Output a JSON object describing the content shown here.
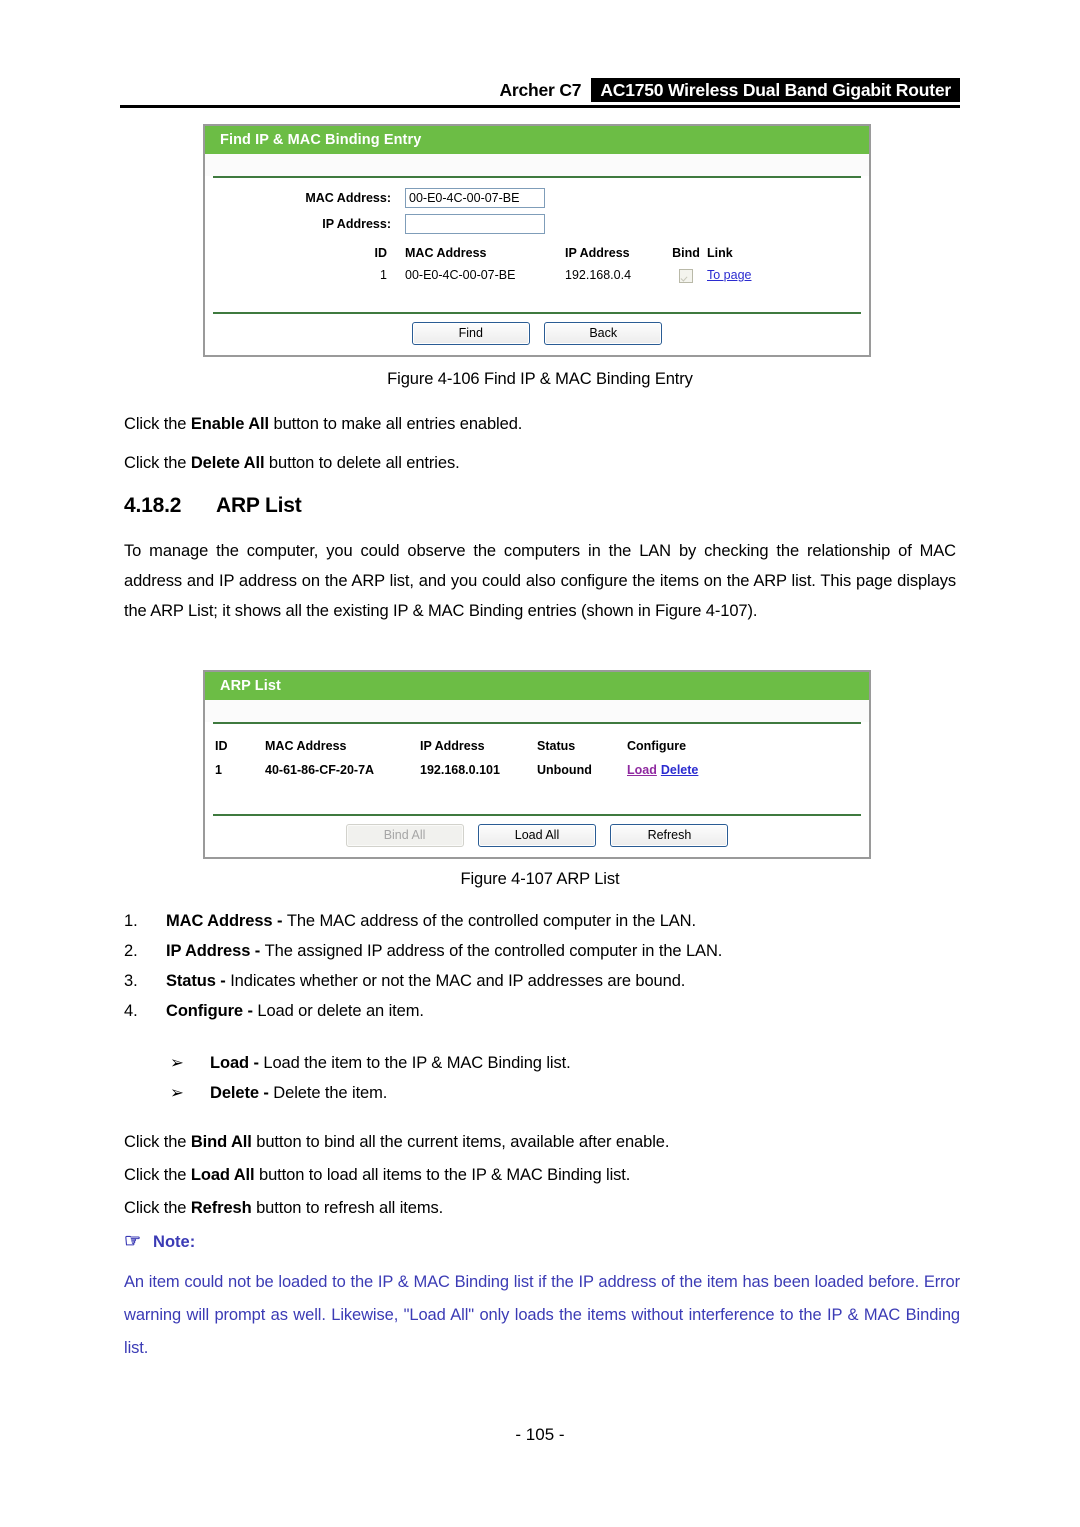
{
  "header": {
    "model": "Archer C7",
    "product": "AC1750 Wireless Dual Band Gigabit Router"
  },
  "figure_find_binding": {
    "panel_title": "Find IP & MAC Binding Entry",
    "fields": [
      {
        "label": "MAC Address:",
        "value": "00-E0-4C-00-07-BE",
        "placeholder": ""
      },
      {
        "label": "IP Address:",
        "value": "",
        "placeholder": ""
      }
    ],
    "table": {
      "columns": [
        "ID",
        "MAC Address",
        "IP Address",
        "Bind",
        "Link"
      ],
      "rows": [
        {
          "id": "1",
          "mac": "00-E0-4C-00-07-BE",
          "ip": "192.168.0.4",
          "bind_checked": true,
          "link": "To page"
        }
      ]
    },
    "buttons": [
      "Find",
      "Back"
    ]
  },
  "caption_106": "Figure 4-106 Find IP & MAC Binding Entry",
  "para_enable_all": {
    "pre": "Click the ",
    "bold": "Enable All",
    "post": " button to make all entries enabled."
  },
  "para_delete_all": {
    "pre": "Click the ",
    "bold": "Delete All",
    "post": " button to delete all entries."
  },
  "section": {
    "number": "4.18.2",
    "title": "ARP List"
  },
  "intro_paragraph": "To manage the computer, you could observe the computers in the LAN by checking the relationship of MAC address and IP address on the ARP list, and you could also configure the items on the ARP list. This page displays the ARP List; it shows all the existing IP & MAC Binding entries (shown in Figure 4-107).",
  "figure_arp_list": {
    "panel_title": "ARP List",
    "table": {
      "columns": [
        "ID",
        "MAC Address",
        "IP Address",
        "Status",
        "Configure"
      ],
      "rows": [
        {
          "id": "1",
          "mac": "40-61-86-CF-20-7A",
          "ip": "192.168.0.101",
          "status": "Unbound",
          "configure": {
            "load": "Load",
            "delete": "Delete"
          }
        }
      ]
    },
    "buttons": [
      {
        "label": "Bind All",
        "disabled": true
      },
      {
        "label": "Load All",
        "disabled": false
      },
      {
        "label": "Refresh",
        "disabled": false
      }
    ]
  },
  "caption_107": "Figure 4-107 ARP List",
  "numbered_items": [
    {
      "marker": "1.",
      "bold": "MAC Address - ",
      "text": "The MAC address of the controlled computer in the LAN."
    },
    {
      "marker": "2.",
      "bold": "IP Address - ",
      "text": "The assigned IP address of the controlled computer in the LAN."
    },
    {
      "marker": "3.",
      "bold": "Status - ",
      "text": "Indicates whether or not the MAC and IP addresses are bound."
    },
    {
      "marker": "4.",
      "bold": "Configure - ",
      "text": "Load or delete an item."
    }
  ],
  "bullet_items": [
    {
      "marker": "➢",
      "bold": "Load - ",
      "text": "Load the item to the IP & MAC Binding list."
    },
    {
      "marker": "➢",
      "bold": "Delete - ",
      "text": "Delete the item."
    }
  ],
  "click_paragraphs": [
    {
      "pre": "Click the ",
      "bold": "Bind All",
      "post": " button to bind all the current items, available after enable."
    },
    {
      "pre": "Click the ",
      "bold": "Load All",
      "post": " button to load all items to the IP & MAC Binding list."
    },
    {
      "pre": "Click the ",
      "bold": "Refresh",
      "post": " button to refresh all items."
    }
  ],
  "note": {
    "icon": "☞",
    "label": "Note:",
    "body": "An item could not be loaded to the IP & MAC Binding list if the IP address of the item has been loaded before. Error warning will prompt as well. Likewise, \"Load All\" only loads the items without interference to the IP & MAC Binding list."
  },
  "footer": {
    "page_number": "- 105 -"
  },
  "colors": {
    "panel_green": "#6cbd45",
    "separator_green": "#3f7a3f",
    "link_blue": "#2b2bd0",
    "link_visited_purple": "#8f2aa0",
    "note_text": "#3b3bb5",
    "button_border": "#2a5c94"
  }
}
